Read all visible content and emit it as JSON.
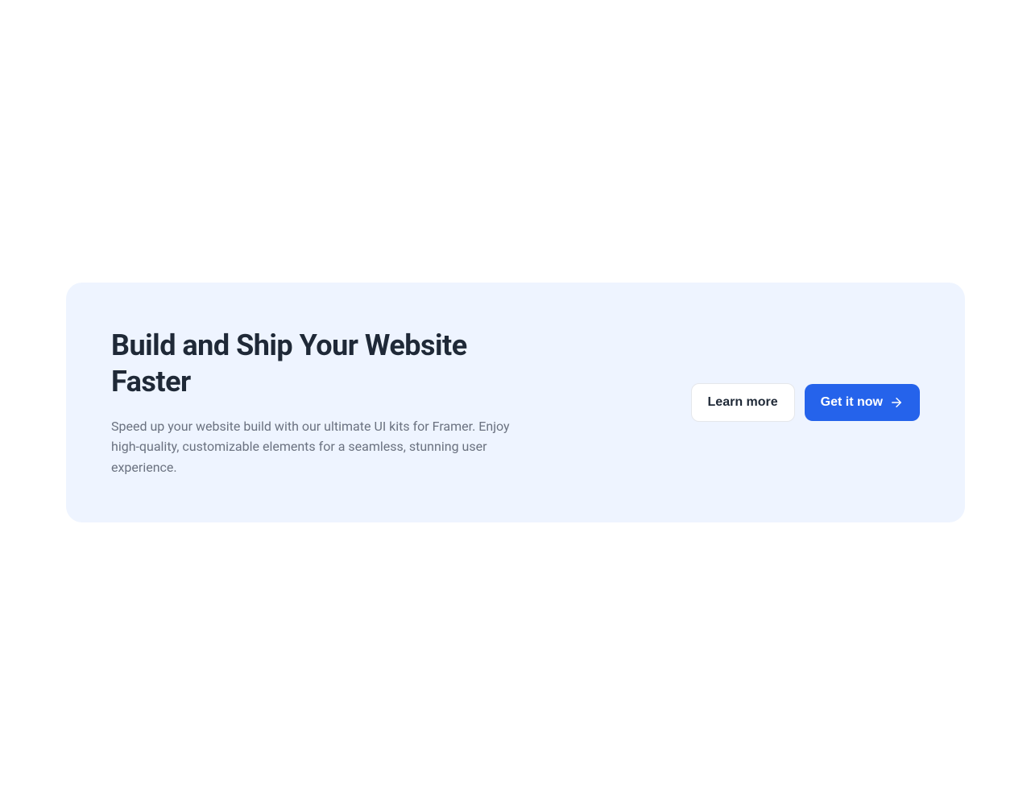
{
  "cta": {
    "heading": "Build and Ship Your Website Faster",
    "description": "Speed up your website build with our ultimate UI kits for Framer. Enjoy high-quality, customizable elements for a seamless, stunning user experience.",
    "secondary_button": "Learn more",
    "primary_button": "Get it now"
  }
}
